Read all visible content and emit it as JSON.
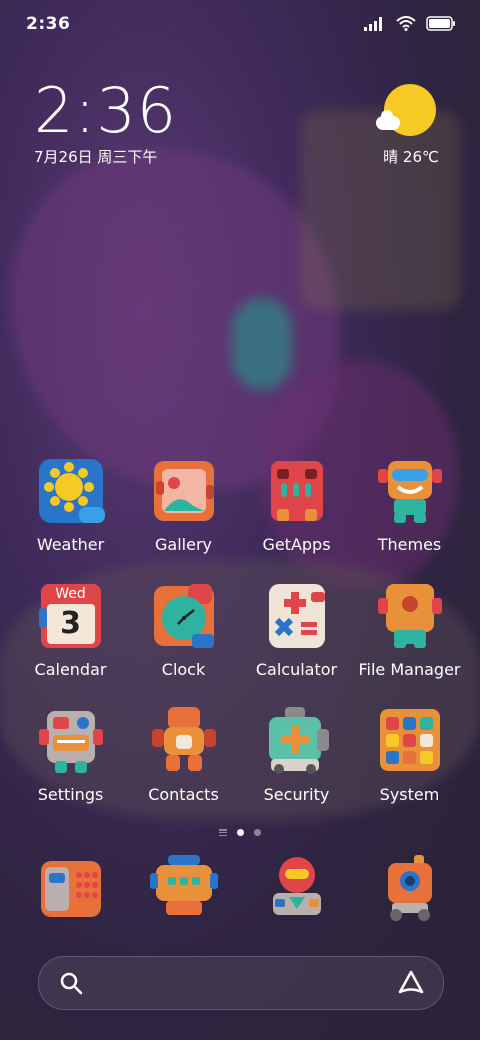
{
  "status_bar": {
    "time": "2:36"
  },
  "lock_widget": {
    "time": "2:36",
    "date": "7月26日 周三下午",
    "weather": "晴 26℃"
  },
  "apps": [
    [
      "Weather",
      "Gallery",
      "GetApps",
      "Themes"
    ],
    [
      "Calendar",
      "Clock",
      "Calculator",
      "File Manager"
    ],
    [
      "Settings",
      "Contacts",
      "Security",
      "System"
    ]
  ],
  "calendar_icon": {
    "day": "Wed",
    "date": "3"
  },
  "page_indicator": {
    "current": 2,
    "total": 2
  },
  "colors": {
    "sun": "#f6c924",
    "background": "#3f2a5a"
  }
}
